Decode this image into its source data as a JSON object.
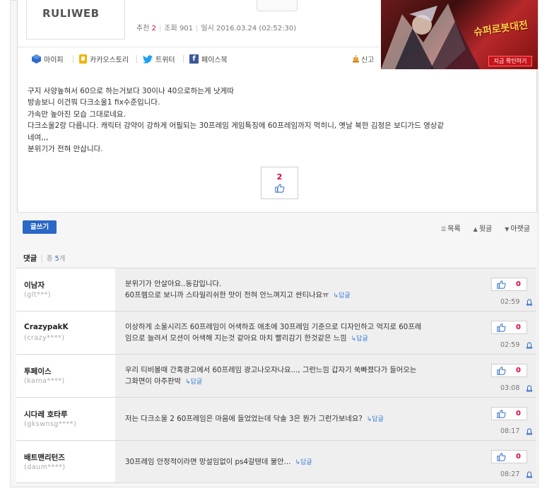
{
  "site": {
    "logo": "RULIWEB"
  },
  "post_meta": {
    "recommend_label": "추천",
    "recommend_count": "2",
    "views_label": "조회",
    "views_count": "901",
    "date_label": "일시",
    "date_value": "2016.03.24 (02:52:30)"
  },
  "share": {
    "mypi": "마이피",
    "kakao": "카카오스토리",
    "twitter": "트위터",
    "facebook": "페이스북",
    "report": "신고"
  },
  "ad": {
    "title": "슈퍼로봇대전",
    "button": "지금 확인하기"
  },
  "post_body": {
    "lines": [
      "구지 사양높혀서 60으로 하는거보다 30이나 40으로하는게 낫게따",
      "방송보니 이건뭐 다크소울1 fix수준입니다.",
      "가속만 높아진 모습 그대로네요.",
      "다크소울2랑 다릅니다. 캐릭터 강약이 강하게 어필되는 30프레임 게임특징에 60프레임까지 먹히니, 옛날 북한 김정은 보디가드 영상같",
      "네여,,,",
      "분위기가 전혀 안삽니다."
    ]
  },
  "recommend_box": {
    "count": "2"
  },
  "actions": {
    "write": "글쓰기",
    "list": "목록",
    "prev": "윗글",
    "next": "아랫글"
  },
  "comments_header": {
    "title": "댓글",
    "total_label": "총",
    "total_count": "5",
    "unit": "개"
  },
  "comments": [
    {
      "name": "이남자",
      "id": "(glt***)",
      "lines": [
        "분위기가 안살아요..동감입니다.",
        "60프렘으로 보니까 스타일리쉬한 맛이 전혀 안느껴지고 싼티나요ㅠ"
      ],
      "reply": "답글",
      "likes": "0",
      "time": "02:59"
    },
    {
      "name": "CrazypakK",
      "id": "(crazy****)",
      "lines": [
        "이상하게 소울시리즈 60프레임이 어색하죠 애초에 30프레임 기준으로 디자인하고 억지로 60프레",
        "임으로 늘려서 모션이 어색해 지는것 같아요 마치 빨리감기 한것같은 느낌"
      ],
      "reply": "답글",
      "likes": "0",
      "time": "02:59"
    },
    {
      "name": "투페이스",
      "id": "(kama****)",
      "lines": [
        "우리 티비볼때 간혹광고에서 60프레임 광고나오자나요..., 그런느낌 갑자기 쑥빠졌다가 들어오는",
        "그화면이 아주판박"
      ],
      "reply": "답글",
      "likes": "0",
      "time": "03:08"
    },
    {
      "name": "시다레 호타루",
      "id": "(gkswnsg****)",
      "lines": [
        "저는 다크소울 2 60프레임은 마음에 들었었는데 닥솔 3은 뭔가 그런가보네요?"
      ],
      "reply": "답글",
      "likes": "0",
      "time": "08:17"
    },
    {
      "name": "배트맨리턴즈",
      "id": "(daum****)",
      "lines": [
        "30프레임 안정적이라면 망설임없이 ps4갈텐데 불안..."
      ],
      "reply": "답글",
      "likes": "0",
      "time": "08:27"
    }
  ]
}
